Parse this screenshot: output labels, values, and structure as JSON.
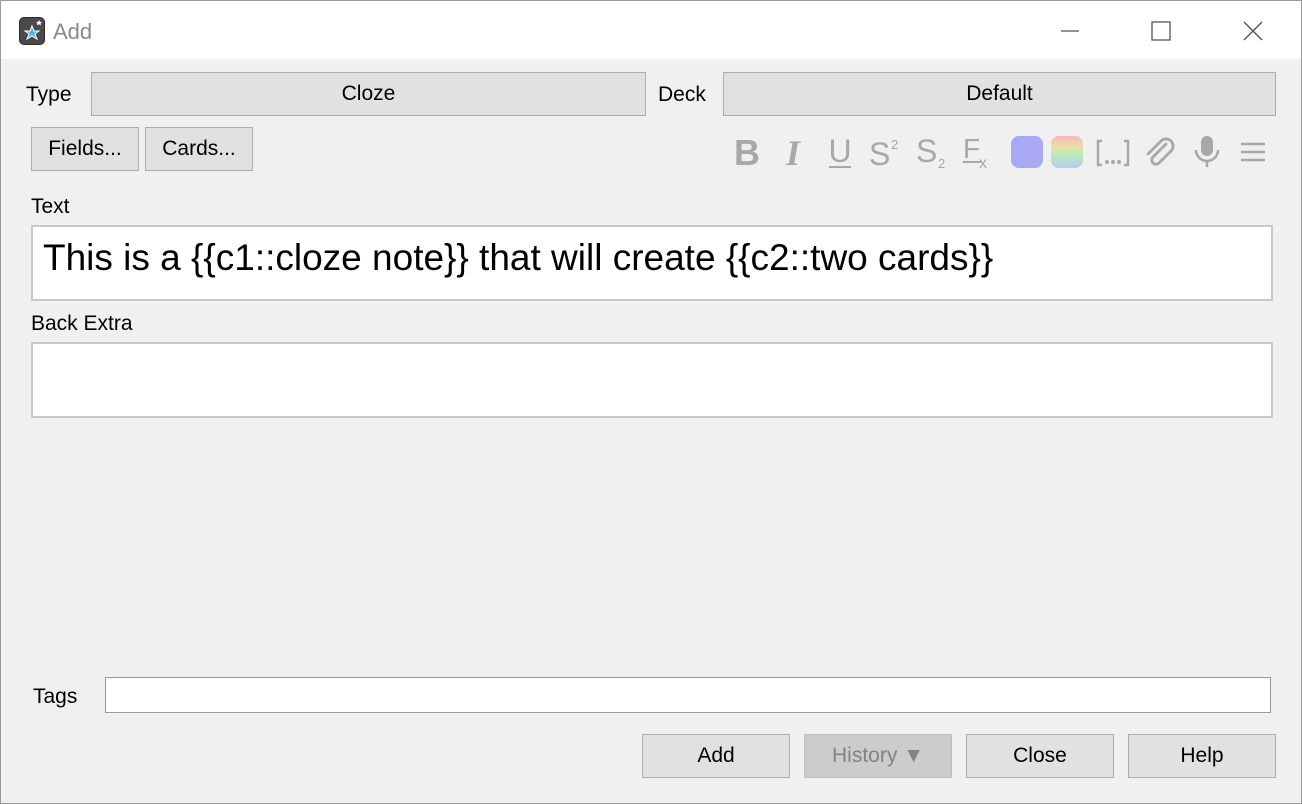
{
  "window": {
    "title": "Add"
  },
  "note_type": {
    "label": "Type",
    "value": "Cloze"
  },
  "deck": {
    "label": "Deck",
    "value": "Default"
  },
  "buttons_top": {
    "fields": "Fields...",
    "cards": "Cards..."
  },
  "toolbar": {
    "icons": [
      "bold-icon",
      "italic-icon",
      "underline-icon",
      "superscript-icon",
      "subscript-icon",
      "clear-formatting-icon",
      "text-color-icon",
      "highlight-color-icon",
      "cloze-icon",
      "attachment-icon",
      "record-audio-icon",
      "more-menu-icon"
    ],
    "text_color": "#a9a9f5",
    "disabled_color": "#a8a8a8"
  },
  "fields": [
    {
      "label": "Text",
      "value": "This is a {{c1::cloze note}} that will create {{c2::two cards}}"
    },
    {
      "label": "Back Extra",
      "value": ""
    }
  ],
  "tags": {
    "label": "Tags",
    "value": ""
  },
  "footer": {
    "add": "Add",
    "history": "History ▼",
    "close": "Close",
    "help": "Help"
  }
}
